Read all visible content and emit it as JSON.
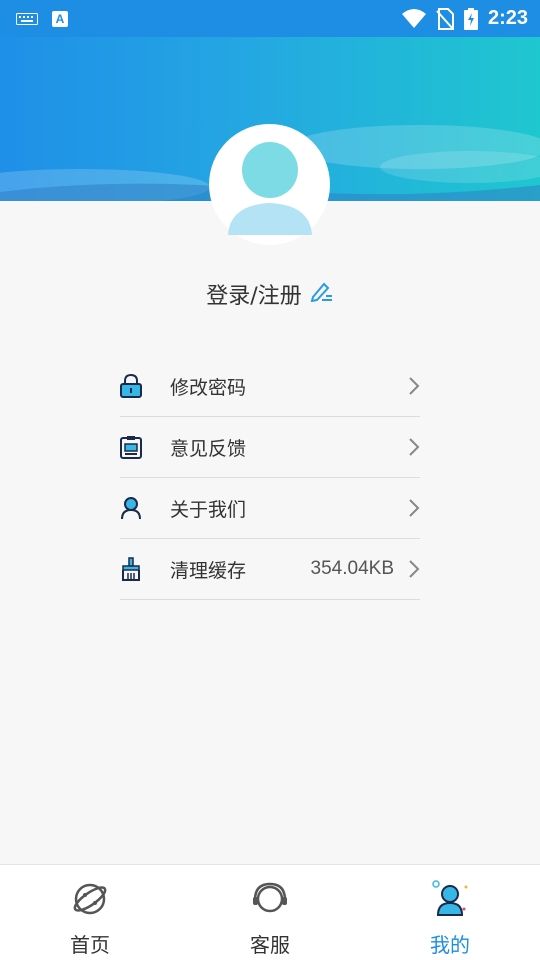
{
  "status_bar": {
    "time": "2:23",
    "icons": [
      "keyboard-icon",
      "a-notification-icon",
      "wifi-icon",
      "no-sim-icon",
      "battery-charging-icon"
    ]
  },
  "profile": {
    "login_text": "登录/注册",
    "edit_icon": "pencil-edit-icon"
  },
  "menu": {
    "items": [
      {
        "label": "修改密码",
        "icon": "lock-icon"
      },
      {
        "label": "意见反馈",
        "icon": "clipboard-icon"
      },
      {
        "label": "关于我们",
        "icon": "user-icon"
      },
      {
        "label": "清理缓存",
        "icon": "broom-icon",
        "value": "354.04KB"
      }
    ]
  },
  "bottom_nav": {
    "items": [
      {
        "label": "首页",
        "icon": "planet-icon"
      },
      {
        "label": "客服",
        "icon": "headset-icon"
      },
      {
        "label": "我的",
        "icon": "person-icon",
        "active": true
      }
    ]
  },
  "colors": {
    "accent": "#1d8ee3",
    "banner_start": "#1f8fe8",
    "banner_end": "#1fc7cf"
  }
}
